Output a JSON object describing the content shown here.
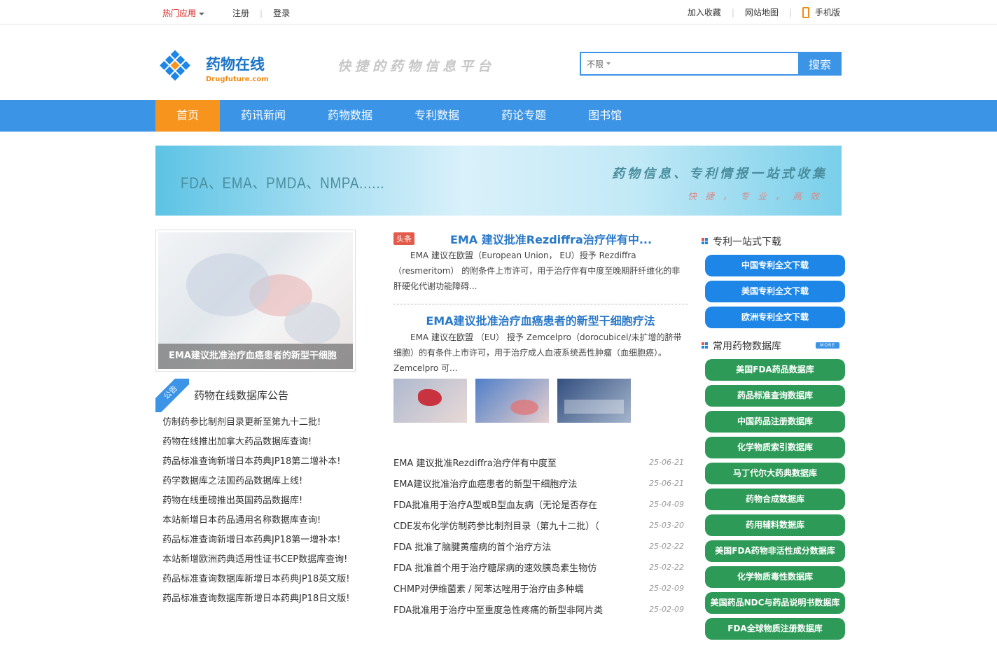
{
  "topbar": {
    "hot_apps": "热门应用",
    "register": "注册",
    "login": "登录",
    "bookmark": "加入收藏",
    "sitemap": "网站地图",
    "mobile": "手机版"
  },
  "header": {
    "logo_text": "药物在线",
    "logo_sub": "Drugfuture.com",
    "slogan": "快捷的药物信息平台",
    "search_scope": "不限",
    "search_placeholder": "",
    "search_button": "搜索"
  },
  "nav": [
    "首页",
    "药讯新闻",
    "药物数据",
    "专利数据",
    "药论专题",
    "图书馆"
  ],
  "banner": {
    "left": "FDA、EMA、PMDA、NMPA......",
    "right": "药物信息、专利情报一站式收集",
    "sub": "快捷，专业，高效"
  },
  "feature": {
    "caption": "EMA建议批准治疗血癌患者的新型干细胞"
  },
  "notice": {
    "ribbon": "公告",
    "title": "药物在线数据库公告",
    "items": [
      "仿制药参比制剂目录更新至第九十二批!",
      "药物在线推出加拿大药品数据库查询!",
      "药品标准查询新增日本药典JP18第二增补本!",
      "药学数据库之法国药品数据库上线!",
      "药物在线重磅推出英国药品数据库!",
      "本站新增日本药品通用名称数据库查询!",
      "药品标准查询新增日本药典JP18第一增补本!",
      "本站新增欧洲药典适用性证书CEP数据库查询!",
      "药品标准查询数据库新增日本药典JP18英文版!",
      "药品标准查询数据库新增日本药典JP18日文版!"
    ]
  },
  "headline": {
    "tag": "头条",
    "title1": "EMA 建议批准Rezdiffra治疗伴有中...",
    "desc1": "EMA 建议在欧盟（European Union， EU）授予 Rezdiffra（resmeritom） 的附条件上市许可，用于治疗伴有中度至晚期肝纤维化的非肝硬化代谢功能障碍...",
    "title2": "EMA建议批准治疗血癌患者的新型干细胞疗法",
    "desc2": "EMA 建议在欧盟 （EU） 授予 Zemcelpro（dorocubicel/未扩增的脐带细胞）的有条件上市许可，用于治疗成人血液系统恶性肿瘤（血细胞癌）。Zemcelpro 可..."
  },
  "newslist": [
    {
      "title": "EMA 建议批准Rezdiffra治疗伴有中度至",
      "date": "25-06-21"
    },
    {
      "title": "EMA建议批准治疗血癌患者的新型干细胞疗法",
      "date": "25-06-21"
    },
    {
      "title": "FDA批准用于治疗A型或B型血友病（无论是否存在",
      "date": "25-04-09"
    },
    {
      "title": "CDE发布化学仿制药参比制剂目录（第九十二批）（",
      "date": "25-03-20"
    },
    {
      "title": "FDA 批准了脑腱黄瘤病的首个治疗方法",
      "date": "25-02-22"
    },
    {
      "title": "FDA 批准首个用于治疗糖尿病的速效胰岛素生物仿",
      "date": "25-02-22"
    },
    {
      "title": "CHMP对伊维菌素 / 阿苯达唑用于治疗由多种蠕",
      "date": "25-02-09"
    },
    {
      "title": "FDA批准用于治疗中至重度急性疼痛的新型非阿片类",
      "date": "25-02-09"
    }
  ],
  "side": {
    "patent_title": "专利一站式下载",
    "patent_buttons": [
      "中国专利全文下载",
      "美国专利全文下载",
      "欧洲专利全文下载"
    ],
    "db_title": "常用药物数据库",
    "more": "MORE",
    "db_buttons": [
      "美国FDA药品数据库",
      "药品标准查询数据库",
      "中国药品注册数据库",
      "化学物质索引数据库",
      "马丁代尔大药典数据库",
      "药物合成数据库",
      "药用辅料数据库",
      "美国FDA药物非活性成分数据库",
      "化学物质毒性数据库",
      "美国药品NDC与药品说明书数据库",
      "FDA全球物质注册数据库"
    ]
  },
  "colors": {
    "nav": "#3b94e6",
    "active": "#f7941d",
    "green_button": "#2d9a57",
    "blue_button": "#1d86e6"
  }
}
